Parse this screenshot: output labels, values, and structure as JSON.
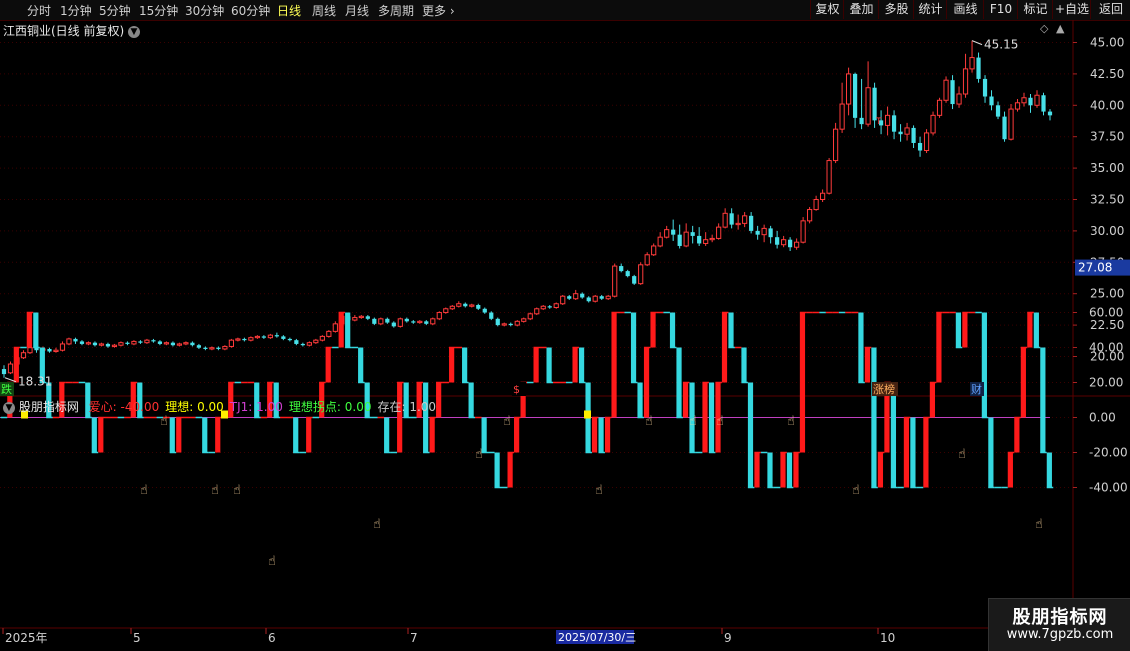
{
  "toolbar": {
    "periods": [
      {
        "label": "分时",
        "active": false
      },
      {
        "label": "1分钟",
        "active": false
      },
      {
        "label": "5分钟",
        "active": false
      },
      {
        "label": "15分钟",
        "active": false
      },
      {
        "label": "30分钟",
        "active": false
      },
      {
        "label": "60分钟",
        "active": false
      },
      {
        "label": "日线",
        "active": true
      },
      {
        "label": "周线",
        "active": false
      },
      {
        "label": "月线",
        "active": false
      },
      {
        "label": "多周期",
        "active": false
      },
      {
        "label": "更多",
        "active": false
      }
    ],
    "tools": [
      "复权",
      "叠加",
      "多股",
      "统计",
      "画线",
      "F10",
      "标记",
      "+自选",
      "返回"
    ]
  },
  "main_chart": {
    "stock_title": "江西铜业(日线 前复权)",
    "high_label": "45.15",
    "low_label": "18.31",
    "current_price": "27.08",
    "y_ticks": [
      "45.00",
      "42.50",
      "40.00",
      "37.50",
      "35.00",
      "32.50",
      "30.00",
      "27.50",
      "25.00",
      "22.50",
      "20.00"
    ],
    "events": [
      {
        "label": "跌"
      },
      {
        "label": "$"
      },
      {
        "label": "涨榜"
      },
      {
        "label": "财"
      }
    ],
    "t_marker": "T",
    "colors": {
      "up": "#ff3b3b",
      "down": "#48e0e8",
      "grid": "#3a0000"
    }
  },
  "indicator": {
    "name": "股朋指标网",
    "values": [
      {
        "label": "爱心: -40.00",
        "color": "#ff3030"
      },
      {
        "label": "理想: 0.00",
        "color": "#ffff00"
      },
      {
        "label": "TJ1: 1.00",
        "color": "#d040d0"
      },
      {
        "label": "理想拐点: 0.00",
        "color": "#40ff40"
      },
      {
        "label": "存在: 1.00",
        "color": "#c8c8c8"
      }
    ],
    "y_ticks": [
      "60.00",
      "40.00",
      "20.00",
      "0.00",
      "-20.00",
      "-40.00"
    ]
  },
  "x_axis": {
    "labels": [
      "2025年",
      "5",
      "6",
      "7",
      "9",
      "10"
    ],
    "highlight": "2025/07/30/三"
  },
  "watermark": {
    "title": "股朋指标网",
    "url": "www.7gpzb.com"
  },
  "chart_data": {
    "type": "candlestick",
    "ylim": [
      18.5,
      46.0
    ],
    "candles": [
      [
        19.0,
        18.6,
        19.3,
        18.31
      ],
      [
        18.7,
        19.4,
        19.6,
        18.6
      ],
      [
        19.4,
        19.9,
        20.0,
        19.3
      ],
      [
        19.9,
        20.3,
        20.5,
        19.8
      ],
      [
        20.3,
        20.7,
        20.9,
        20.2
      ],
      [
        20.7,
        20.5,
        20.8,
        20.3
      ],
      [
        20.5,
        20.6,
        20.8,
        20.4
      ],
      [
        20.6,
        20.4,
        20.7,
        20.3
      ],
      [
        20.4,
        20.5,
        20.7,
        20.3
      ],
      [
        20.5,
        21.0,
        21.2,
        20.4
      ],
      [
        21.0,
        21.4,
        21.5,
        20.9
      ],
      [
        21.4,
        21.2,
        21.5,
        21.0
      ],
      [
        21.2,
        21.0,
        21.3,
        20.9
      ],
      [
        21.0,
        21.1,
        21.2,
        20.9
      ],
      [
        21.1,
        20.9,
        21.2,
        20.8
      ],
      [
        20.9,
        21.0,
        21.1,
        20.8
      ],
      [
        21.0,
        20.8,
        21.1,
        20.7
      ],
      [
        20.8,
        20.9,
        21.0,
        20.7
      ],
      [
        20.9,
        21.1,
        21.2,
        20.8
      ],
      [
        21.1,
        21.0,
        21.2,
        20.9
      ],
      [
        21.0,
        21.2,
        21.3,
        20.9
      ],
      [
        21.2,
        21.1,
        21.3,
        21.0
      ],
      [
        21.1,
        21.3,
        21.4,
        21.0
      ],
      [
        21.3,
        21.2,
        21.4,
        21.1
      ],
      [
        21.2,
        21.0,
        21.3,
        20.9
      ],
      [
        21.0,
        21.1,
        21.2,
        20.9
      ],
      [
        21.1,
        20.9,
        21.2,
        20.8
      ],
      [
        20.9,
        21.0,
        21.1,
        20.8
      ],
      [
        21.0,
        21.1,
        21.2,
        20.9
      ],
      [
        21.1,
        20.9,
        21.2,
        20.8
      ],
      [
        20.9,
        20.7,
        21.0,
        20.6
      ],
      [
        20.7,
        20.6,
        20.8,
        20.5
      ],
      [
        20.6,
        20.7,
        20.8,
        20.5
      ],
      [
        20.7,
        20.6,
        20.8,
        20.5
      ],
      [
        20.6,
        20.8,
        20.9,
        20.5
      ],
      [
        20.8,
        21.3,
        21.4,
        20.7
      ],
      [
        21.3,
        21.4,
        21.5,
        21.2
      ],
      [
        21.4,
        21.3,
        21.5,
        21.2
      ],
      [
        21.3,
        21.5,
        21.6,
        21.2
      ],
      [
        21.5,
        21.6,
        21.7,
        21.4
      ],
      [
        21.6,
        21.5,
        21.7,
        21.4
      ],
      [
        21.5,
        21.7,
        21.8,
        21.4
      ],
      [
        21.7,
        21.6,
        21.9,
        21.5
      ],
      [
        21.6,
        21.4,
        21.7,
        21.3
      ],
      [
        21.4,
        21.3,
        21.5,
        21.2
      ],
      [
        21.3,
        21.0,
        21.4,
        20.9
      ],
      [
        21.0,
        20.9,
        21.1,
        20.8
      ],
      [
        20.9,
        21.1,
        21.2,
        20.8
      ],
      [
        21.1,
        21.3,
        21.4,
        21.0
      ],
      [
        21.3,
        21.6,
        21.7,
        21.2
      ],
      [
        21.6,
        22.0,
        22.1,
        21.5
      ],
      [
        22.0,
        22.6,
        22.8,
        21.9
      ],
      [
        22.6,
        23.2,
        23.4,
        22.5
      ],
      [
        23.2,
        22.9,
        23.4,
        22.8
      ],
      [
        22.9,
        23.1,
        23.3,
        22.8
      ],
      [
        23.1,
        23.2,
        23.3,
        23.0
      ],
      [
        23.2,
        23.0,
        23.3,
        22.9
      ],
      [
        23.0,
        22.6,
        23.1,
        22.5
      ],
      [
        22.6,
        23.0,
        23.1,
        22.5
      ],
      [
        23.0,
        22.7,
        23.1,
        22.6
      ],
      [
        22.7,
        22.4,
        22.8,
        22.3
      ],
      [
        22.4,
        23.0,
        23.1,
        22.3
      ],
      [
        23.0,
        22.8,
        23.1,
        22.7
      ],
      [
        22.8,
        22.7,
        22.9,
        22.6
      ],
      [
        22.7,
        22.8,
        22.9,
        22.6
      ],
      [
        22.8,
        22.6,
        22.9,
        22.5
      ],
      [
        22.6,
        23.0,
        23.1,
        22.5
      ],
      [
        23.0,
        23.5,
        23.6,
        22.9
      ],
      [
        23.5,
        23.8,
        23.9,
        23.4
      ],
      [
        23.8,
        24.0,
        24.1,
        23.7
      ],
      [
        24.0,
        24.2,
        24.4,
        23.9
      ],
      [
        24.2,
        24.0,
        24.3,
        23.9
      ],
      [
        24.0,
        24.1,
        24.2,
        23.9
      ],
      [
        24.1,
        23.8,
        24.2,
        23.7
      ],
      [
        23.8,
        23.5,
        23.9,
        23.4
      ],
      [
        23.5,
        23.0,
        23.6,
        22.9
      ],
      [
        23.0,
        22.5,
        23.1,
        22.4
      ],
      [
        22.5,
        22.6,
        22.7,
        22.4
      ],
      [
        22.6,
        22.5,
        22.7,
        22.4
      ],
      [
        22.5,
        22.8,
        22.9,
        22.4
      ],
      [
        22.8,
        23.0,
        23.1,
        22.7
      ],
      [
        23.0,
        23.4,
        23.5,
        22.9
      ],
      [
        23.4,
        23.8,
        23.9,
        23.3
      ],
      [
        23.8,
        24.0,
        24.1,
        23.7
      ],
      [
        24.0,
        23.9,
        24.1,
        23.8
      ],
      [
        23.9,
        24.2,
        24.3,
        23.8
      ],
      [
        24.2,
        24.8,
        24.9,
        24.1
      ],
      [
        24.8,
        24.6,
        24.9,
        24.5
      ],
      [
        24.6,
        25.0,
        25.3,
        24.5
      ],
      [
        25.0,
        24.7,
        25.1,
        24.6
      ],
      [
        24.7,
        24.4,
        24.8,
        24.3
      ],
      [
        24.4,
        24.8,
        24.9,
        24.3
      ],
      [
        24.8,
        24.6,
        24.9,
        24.5
      ],
      [
        24.6,
        24.8,
        24.9,
        24.5
      ],
      [
        24.8,
        27.2,
        27.4,
        24.7
      ],
      [
        27.2,
        26.8,
        27.4,
        26.7
      ],
      [
        26.8,
        26.4,
        26.9,
        26.3
      ],
      [
        26.4,
        25.8,
        26.5,
        25.7
      ],
      [
        25.8,
        27.3,
        27.5,
        25.7
      ],
      [
        27.3,
        28.1,
        28.3,
        27.2
      ],
      [
        28.1,
        28.8,
        29.0,
        28.0
      ],
      [
        28.8,
        29.5,
        29.9,
        28.7
      ],
      [
        29.5,
        30.1,
        30.4,
        29.4
      ],
      [
        30.1,
        29.7,
        30.9,
        29.2
      ],
      [
        29.7,
        28.8,
        30.5,
        28.6
      ],
      [
        28.8,
        29.9,
        30.6,
        28.7
      ],
      [
        29.9,
        29.6,
        30.4,
        29.0
      ],
      [
        29.6,
        29.0,
        30.3,
        28.8
      ],
      [
        29.0,
        29.3,
        29.9,
        28.8
      ],
      [
        29.3,
        29.4,
        29.7,
        29.1
      ],
      [
        29.4,
        30.3,
        30.6,
        29.3
      ],
      [
        30.3,
        31.4,
        31.8,
        30.2
      ],
      [
        31.4,
        30.5,
        31.8,
        30.2
      ],
      [
        30.5,
        30.6,
        31.3,
        30.1
      ],
      [
        30.6,
        31.2,
        31.5,
        30.3
      ],
      [
        31.2,
        30.0,
        31.5,
        29.8
      ],
      [
        30.0,
        29.7,
        30.4,
        29.3
      ],
      [
        29.7,
        30.2,
        30.5,
        29.1
      ],
      [
        30.2,
        29.5,
        30.4,
        29.0
      ],
      [
        29.5,
        28.9,
        30.0,
        28.6
      ],
      [
        28.9,
        29.3,
        29.6,
        28.7
      ],
      [
        29.3,
        28.7,
        29.5,
        28.4
      ],
      [
        28.7,
        29.1,
        29.4,
        28.5
      ],
      [
        29.1,
        30.8,
        31.1,
        29.0
      ],
      [
        30.8,
        31.7,
        31.9,
        30.6
      ],
      [
        31.7,
        32.5,
        32.8,
        31.6
      ],
      [
        32.5,
        33.0,
        33.3,
        32.3
      ],
      [
        33.0,
        35.6,
        35.8,
        32.9
      ],
      [
        35.6,
        38.1,
        38.6,
        35.4
      ],
      [
        38.1,
        40.1,
        41.8,
        37.8
      ],
      [
        40.1,
        42.5,
        43.0,
        39.2
      ],
      [
        42.5,
        39.0,
        42.6,
        38.2
      ],
      [
        39.0,
        38.5,
        42.1,
        38.1
      ],
      [
        38.5,
        41.4,
        43.5,
        38.3
      ],
      [
        41.4,
        38.8,
        41.8,
        38.2
      ],
      [
        38.8,
        38.4,
        39.6,
        37.7
      ],
      [
        38.4,
        39.2,
        39.9,
        37.6
      ],
      [
        39.2,
        37.9,
        39.6,
        37.3
      ],
      [
        37.9,
        37.7,
        38.5,
        37.1
      ],
      [
        37.7,
        38.2,
        38.6,
        37.2
      ],
      [
        38.2,
        37.0,
        38.4,
        36.6
      ],
      [
        37.0,
        36.4,
        37.5,
        35.9
      ],
      [
        36.4,
        37.8,
        38.1,
        36.2
      ],
      [
        37.8,
        39.2,
        39.5,
        37.6
      ],
      [
        39.2,
        40.4,
        40.6,
        39.0
      ],
      [
        40.4,
        42.0,
        42.3,
        40.2
      ],
      [
        42.0,
        40.1,
        42.4,
        39.7
      ],
      [
        40.1,
        40.9,
        41.5,
        39.8
      ],
      [
        40.9,
        42.9,
        44.1,
        40.6
      ],
      [
        42.9,
        43.8,
        45.15,
        42.6
      ],
      [
        43.8,
        42.1,
        44.2,
        41.8
      ],
      [
        42.1,
        40.7,
        42.4,
        40.2
      ],
      [
        40.7,
        40.0,
        41.2,
        39.6
      ],
      [
        40.0,
        39.1,
        40.3,
        38.9
      ],
      [
        39.1,
        37.3,
        39.5,
        37.1
      ],
      [
        37.3,
        39.7,
        40.1,
        37.2
      ],
      [
        39.7,
        40.2,
        40.5,
        39.5
      ],
      [
        40.2,
        40.6,
        41.0,
        39.9
      ],
      [
        40.6,
        40.0,
        40.9,
        39.4
      ],
      [
        40.0,
        40.8,
        41.2,
        39.8
      ],
      [
        40.8,
        39.5,
        41.0,
        39.2
      ],
      [
        39.5,
        39.2,
        39.7,
        38.8
      ]
    ]
  }
}
